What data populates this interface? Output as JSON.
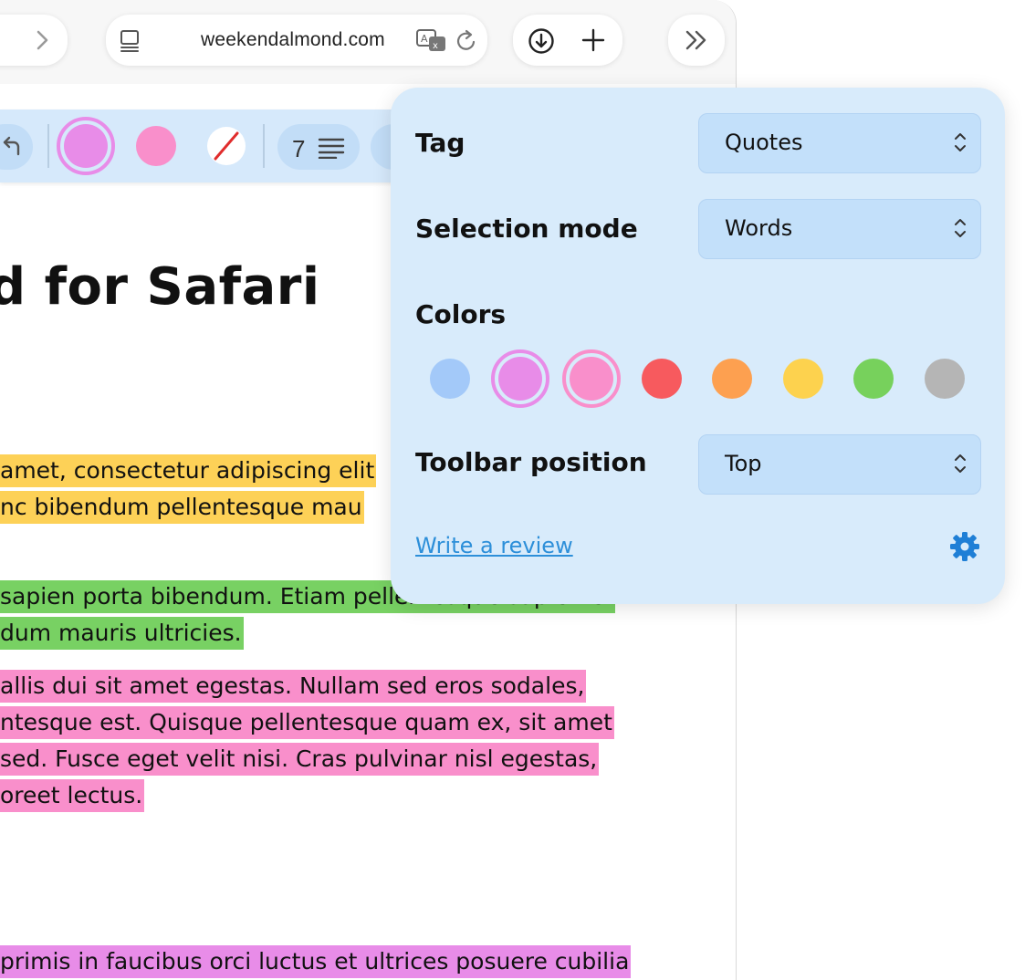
{
  "browser": {
    "url": "weekendalmond.com"
  },
  "toolbar": {
    "highlight_count": "7",
    "swatch_colors": [
      "#e88ce8",
      "#f98fcb"
    ]
  },
  "article": {
    "title": "d for Safari",
    "highlights": [
      {
        "color": "yellow",
        "text": "amet, consectetur adipiscing elit"
      },
      {
        "color": "yellow",
        "text": "nc bibendum pellentesque mau"
      },
      {
        "color": "green",
        "text": "sapien porta bibendum. Etiam pellentesque sapien et"
      },
      {
        "color": "green",
        "text": "dum mauris ultricies."
      },
      {
        "color": "pink",
        "text": "allis dui sit amet egestas. Nullam sed eros sodales,"
      },
      {
        "color": "pink",
        "text": "ntesque est. Quisque pellentesque quam ex, sit amet"
      },
      {
        "color": "pink",
        "text": " sed. Fusce eget velit nisi. Cras pulvinar nisl egestas,"
      },
      {
        "color": "pink",
        "text": "oreet lectus."
      },
      {
        "color": "violet",
        "text": " primis in faucibus orci luctus et ultrices posuere cubilia"
      }
    ]
  },
  "popover": {
    "tag_label": "Tag",
    "tag_value": "Quotes",
    "selection_mode_label": "Selection mode",
    "selection_mode_value": "Words",
    "colors_label": "Colors",
    "colors": [
      {
        "name": "blue",
        "hex": "#a3c9f9",
        "selected": false
      },
      {
        "name": "violet",
        "hex": "#e88ce8",
        "selected": true
      },
      {
        "name": "pink",
        "hex": "#f98fcb",
        "selected": true
      },
      {
        "name": "red",
        "hex": "#f75a5e",
        "selected": false
      },
      {
        "name": "orange",
        "hex": "#fda050",
        "selected": false
      },
      {
        "name": "yellow",
        "hex": "#fdd24e",
        "selected": false
      },
      {
        "name": "green",
        "hex": "#77d15c",
        "selected": false
      },
      {
        "name": "gray",
        "hex": "#b5b5b5",
        "selected": false
      }
    ],
    "toolbar_position_label": "Toolbar position",
    "toolbar_position_value": "Top",
    "review_link": "Write a review"
  }
}
